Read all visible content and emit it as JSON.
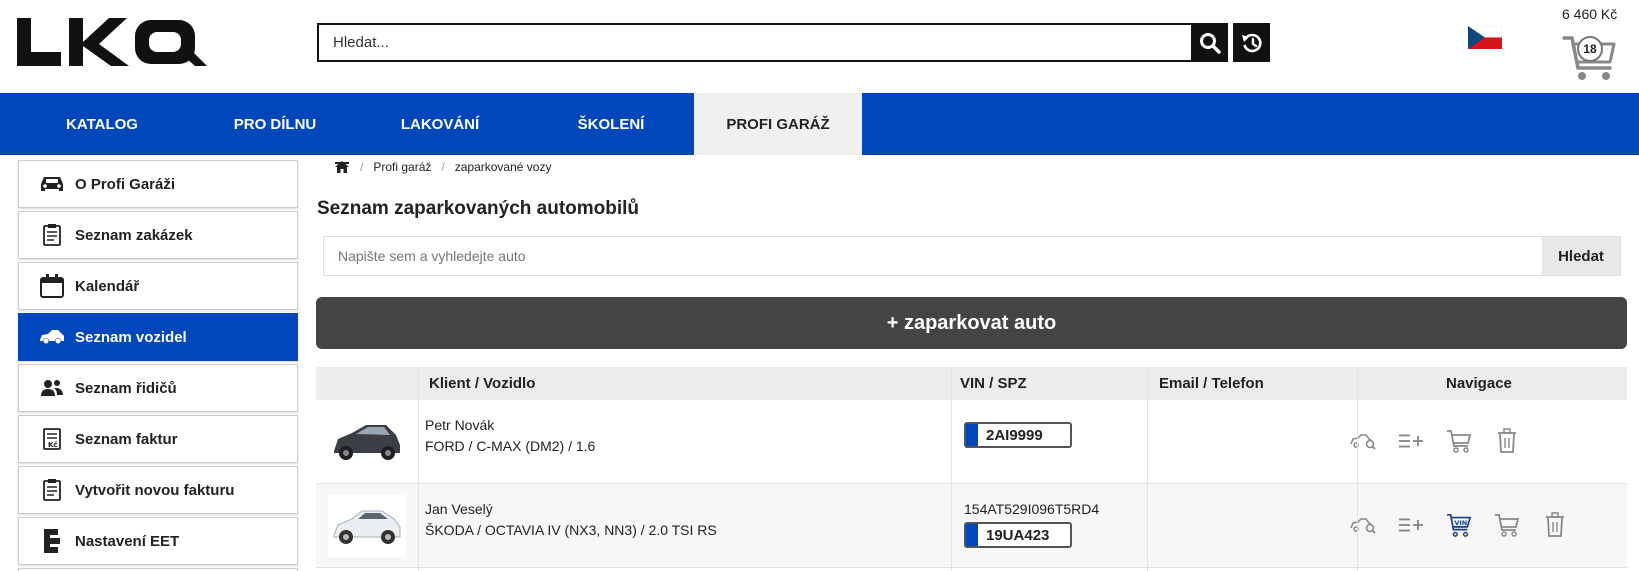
{
  "header": {
    "logo_text": "LKQ",
    "search_placeholder": "Hledat...",
    "cart_total": "6 460 Kč",
    "cart_count": "18"
  },
  "nav": {
    "items": [
      {
        "label": "KATALOG"
      },
      {
        "label": "PRO DÍLNU"
      },
      {
        "label": "LAKOVÁNÍ"
      },
      {
        "label": "ŠKOLENÍ"
      },
      {
        "label": "PROFI GARÁŽ"
      }
    ]
  },
  "sidebar": {
    "items": [
      {
        "label": "O Profi Garáži",
        "icon": "car-front-icon"
      },
      {
        "label": "Seznam zakázek",
        "icon": "clipboard-list-icon"
      },
      {
        "label": "Kalendář",
        "icon": "calendar-icon"
      },
      {
        "label": "Seznam vozidel",
        "icon": "car-side-icon"
      },
      {
        "label": "Seznam řidičů",
        "icon": "users-icon"
      },
      {
        "label": "Seznam faktur",
        "icon": "invoice-icon"
      },
      {
        "label": "Vytvořit novou fakturu",
        "icon": "clipboard-list-icon"
      },
      {
        "label": "Nastavení EET",
        "icon": "eet-icon"
      }
    ]
  },
  "breadcrumb": {
    "items": [
      "Profi garáž",
      "zaparkované vozy"
    ]
  },
  "main": {
    "title": "Seznam zaparkovaných automobilů",
    "search_placeholder": "Napište sem a vyhledejte auto",
    "search_button": "Hledat",
    "park_button": "+ zaparkovat auto"
  },
  "table": {
    "columns": [
      "Klient / Vozidlo",
      "VIN / SPZ",
      "Email / Telefon",
      "Navigace"
    ],
    "rows": [
      {
        "client": "Petr Novák",
        "vehicle": "FORD / C-MAX (DM2) / 1.6",
        "vin": "",
        "plate": "2AI9999",
        "contact": ""
      },
      {
        "client": "Jan Veselý",
        "vehicle": "ŠKODA / OCTAVIA IV (NX3, NN3) / 2.0 TSI RS",
        "vin": "154AT529I096T5RD4",
        "plate": "19UA423",
        "contact": ""
      }
    ]
  },
  "colors": {
    "brand_blue": "#0047bb",
    "dark_button": "#444444"
  }
}
